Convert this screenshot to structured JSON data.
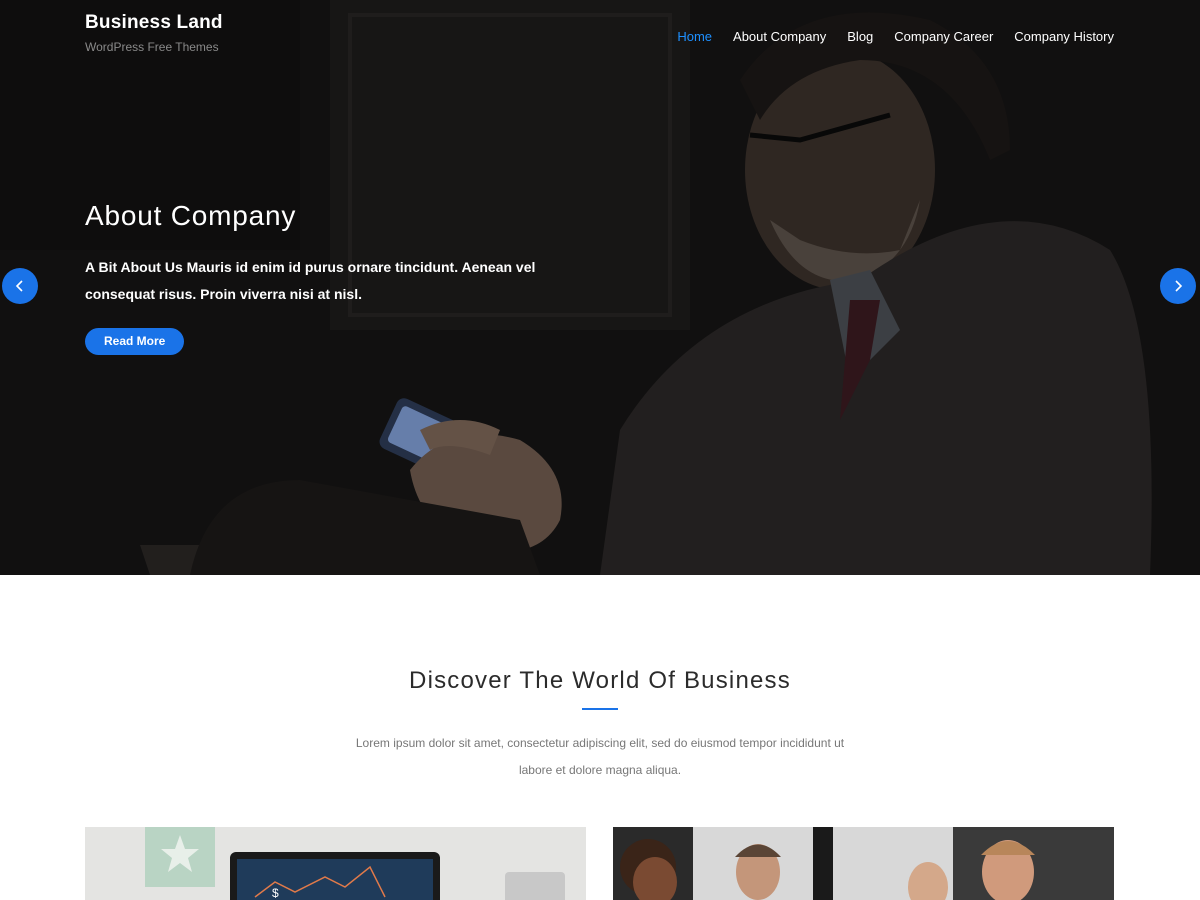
{
  "site": {
    "title": "Business Land",
    "tagline": "WordPress Free Themes"
  },
  "nav": {
    "items": [
      {
        "label": "Home",
        "active": true
      },
      {
        "label": "About Company",
        "active": false
      },
      {
        "label": "Blog",
        "active": false
      },
      {
        "label": "Company Career",
        "active": false
      },
      {
        "label": "Company History",
        "active": false
      }
    ]
  },
  "slider": {
    "title": "About Company",
    "text": "A Bit About Us Mauris id enim id purus ornare tincidunt. Aenean vel consequat risus. Proin viverra nisi at nisl.",
    "button_label": "Read More",
    "prev_icon": "chevron-left-icon",
    "next_icon": "chevron-right-icon"
  },
  "discover": {
    "title": "Discover The World Of Business",
    "description": "Lorem ipsum dolor sit amet, consectetur adipiscing elit, sed do eiusmod tempor incididunt ut labore et dolore magna aliqua."
  },
  "colors": {
    "accent": "#1a73e8",
    "active_nav": "#1e90ff",
    "hero_bg": "#141312"
  }
}
